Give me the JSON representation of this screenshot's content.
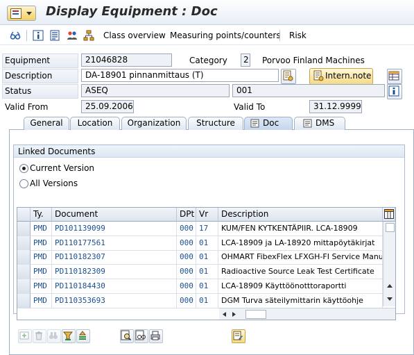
{
  "window": {
    "title": "Display Equipment : Doc"
  },
  "toolbar": {
    "class_overview": "Class overview",
    "measuring_points": "Measuring points/counters",
    "risk": "Risk"
  },
  "form": {
    "equipment_label": "Equipment",
    "equipment_value": "21046828",
    "category_label": "Category",
    "category_value": "2",
    "category_text": "Porvoo Finland Machines",
    "description_label": "Description",
    "description_value": "DA-18901 pinnanmittaus (T)",
    "intern_note_label": "Intern.note",
    "status_label": "Status",
    "status_value": "ASEQ",
    "status_value2": "001",
    "valid_from_label": "Valid From",
    "valid_from_value": "25.09.2006",
    "valid_to_label": "Valid To",
    "valid_to_value": "31.12.9999"
  },
  "tabs": [
    "General",
    "Location",
    "Organization",
    "Structure",
    "Doc",
    "DMS"
  ],
  "active_tab": "Doc",
  "linked_documents": {
    "title": "Linked Documents",
    "radio_current": "Current Version",
    "radio_all": "All Versions",
    "selected": "current"
  },
  "table": {
    "columns": [
      "Ty.",
      "Document",
      "DPt",
      "Vr",
      "Description"
    ],
    "rows": [
      {
        "ty": "PMD",
        "doc": "PD101139099",
        "dpt": "000",
        "vr": "17",
        "desc": "KUM/FEN KYTKENTÄPIIR. LCA-18909"
      },
      {
        "ty": "PMD",
        "doc": "PD110177561",
        "dpt": "000",
        "vr": "01",
        "desc": "LCA-18909 ja LA-18920 mittapöytäkirjat"
      },
      {
        "ty": "PMD",
        "doc": "PD110182307",
        "dpt": "000",
        "vr": "01",
        "desc": "OHMART FibexFlex LFXGH-FI Service Manua"
      },
      {
        "ty": "PMD",
        "doc": "PD110182309",
        "dpt": "000",
        "vr": "01",
        "desc": "Radioactive Source Leak Test Certificate"
      },
      {
        "ty": "PMD",
        "doc": "PD110184430",
        "dpt": "000",
        "vr": "01",
        "desc": "LCA-18909 Käyttöönotttoraportti"
      },
      {
        "ty": "PMD",
        "doc": "PD110353693",
        "dpt": "000",
        "vr": "01",
        "desc": "DGM Turva säteilymittarin käyttöohje"
      }
    ]
  },
  "colors": {
    "accent": "#1b4f91",
    "tab_border": "#9fb0c6",
    "button_yellow": "#f4da88"
  },
  "icons": [
    "menu-icon",
    "glasses-icon",
    "info-icon",
    "document-icon",
    "partners-icon",
    "hierarchy-icon",
    "note-icon",
    "long-text-icon",
    "grid-layout-icon"
  ]
}
